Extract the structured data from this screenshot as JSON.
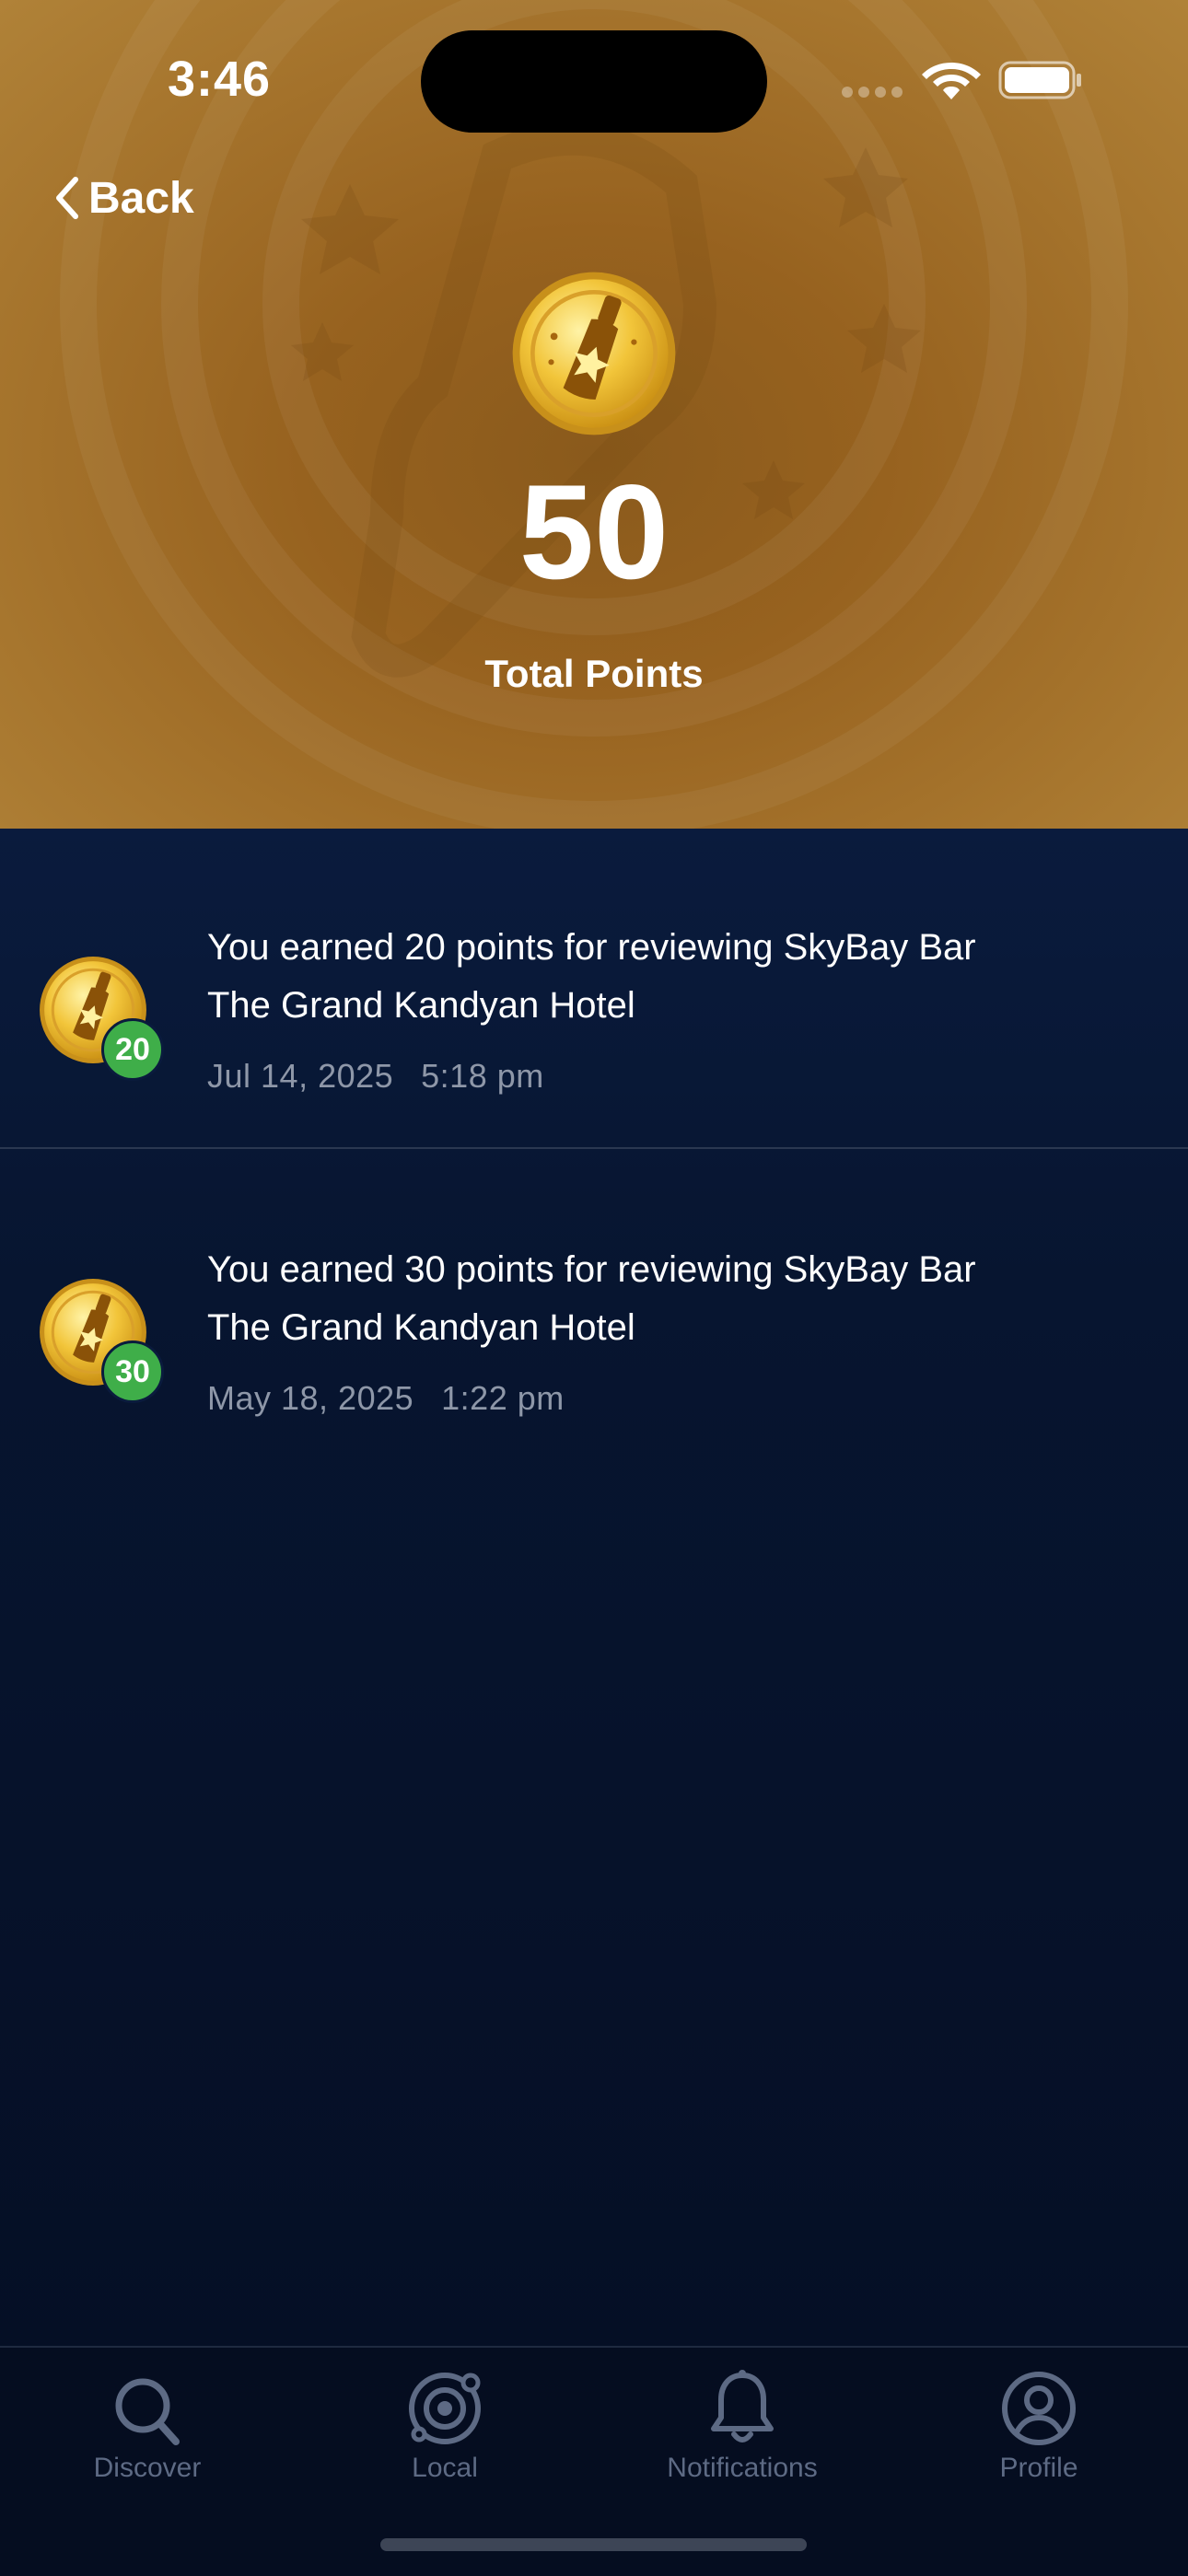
{
  "status_bar": {
    "time": "3:46"
  },
  "header": {
    "back_label": "Back",
    "total_points": "50",
    "total_label": "Total Points"
  },
  "activity": [
    {
      "badge": "20",
      "text": "You earned 20 points for reviewing SkyBay Bar The Grand Kandyan Hotel",
      "date": "Jul 14, 2025",
      "time": "5:18 pm"
    },
    {
      "badge": "30",
      "text": "You earned 30 points for reviewing SkyBay Bar The Grand Kandyan Hotel",
      "date": "May 18, 2025",
      "time": "1:22 pm"
    }
  ],
  "tabs": [
    {
      "label": "Discover",
      "icon": "search-icon"
    },
    {
      "label": "Local",
      "icon": "location-target-icon"
    },
    {
      "label": "Notifications",
      "icon": "bell-icon"
    },
    {
      "label": "Profile",
      "icon": "profile-icon"
    }
  ],
  "colors": {
    "header_gold": "#97621f",
    "background_navy": "#06122a",
    "badge_green": "#3fae49",
    "tab_inactive": "#5d6a84",
    "date_gray": "#8e97a8"
  }
}
